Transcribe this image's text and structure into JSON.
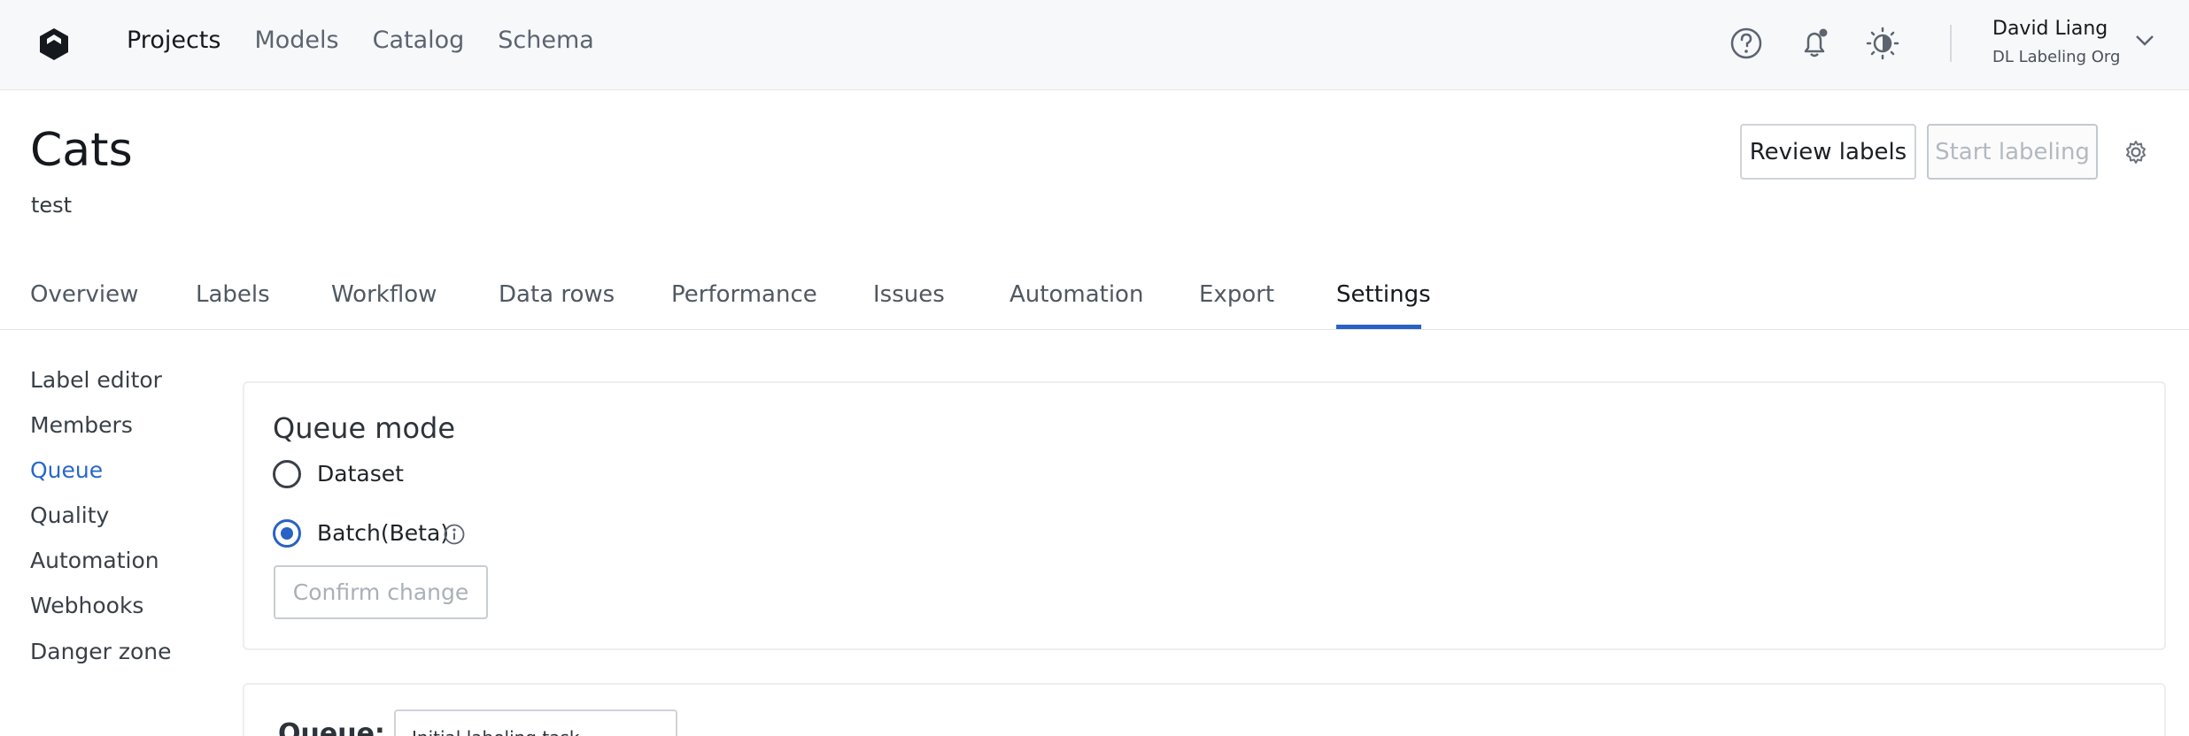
{
  "topnav": {
    "items": [
      {
        "label": "Projects",
        "active": true
      },
      {
        "label": "Models",
        "active": false
      },
      {
        "label": "Catalog",
        "active": false
      },
      {
        "label": "Schema",
        "active": false
      }
    ],
    "icons": [
      "help-icon",
      "notifications-icon",
      "theme-toggle-icon"
    ],
    "user": {
      "name": "David Liang",
      "org": "DL Labeling Org"
    }
  },
  "project": {
    "title": "Cats",
    "description": "test",
    "review_button": "Review labels",
    "start_button": "Start labeling"
  },
  "tabs": [
    {
      "label": "Overview",
      "active": false
    },
    {
      "label": "Labels",
      "active": false
    },
    {
      "label": "Workflow",
      "active": false
    },
    {
      "label": "Data rows",
      "active": false
    },
    {
      "label": "Performance",
      "active": false
    },
    {
      "label": "Issues",
      "active": false
    },
    {
      "label": "Automation",
      "active": false
    },
    {
      "label": "Export",
      "active": false
    },
    {
      "label": "Settings",
      "active": true
    }
  ],
  "settings_menu": [
    {
      "label": "Label editor",
      "active": false
    },
    {
      "label": "Members",
      "active": false
    },
    {
      "label": "Queue",
      "active": true
    },
    {
      "label": "Quality",
      "active": false
    },
    {
      "label": "Automation",
      "active": false
    },
    {
      "label": "Webhooks",
      "active": false
    },
    {
      "label": "Danger zone",
      "active": false
    }
  ],
  "queue_mode": {
    "title": "Queue mode",
    "options": [
      {
        "label": "Dataset",
        "selected": false
      },
      {
        "label": "Batch(Beta)",
        "selected": true
      }
    ],
    "confirm_button": "Confirm change"
  },
  "queue_section": {
    "label": "Queue:",
    "selected": "Initial labeling task"
  },
  "colors": {
    "accent": "#2962c4",
    "topbar_bg": "#f7f8fa"
  }
}
